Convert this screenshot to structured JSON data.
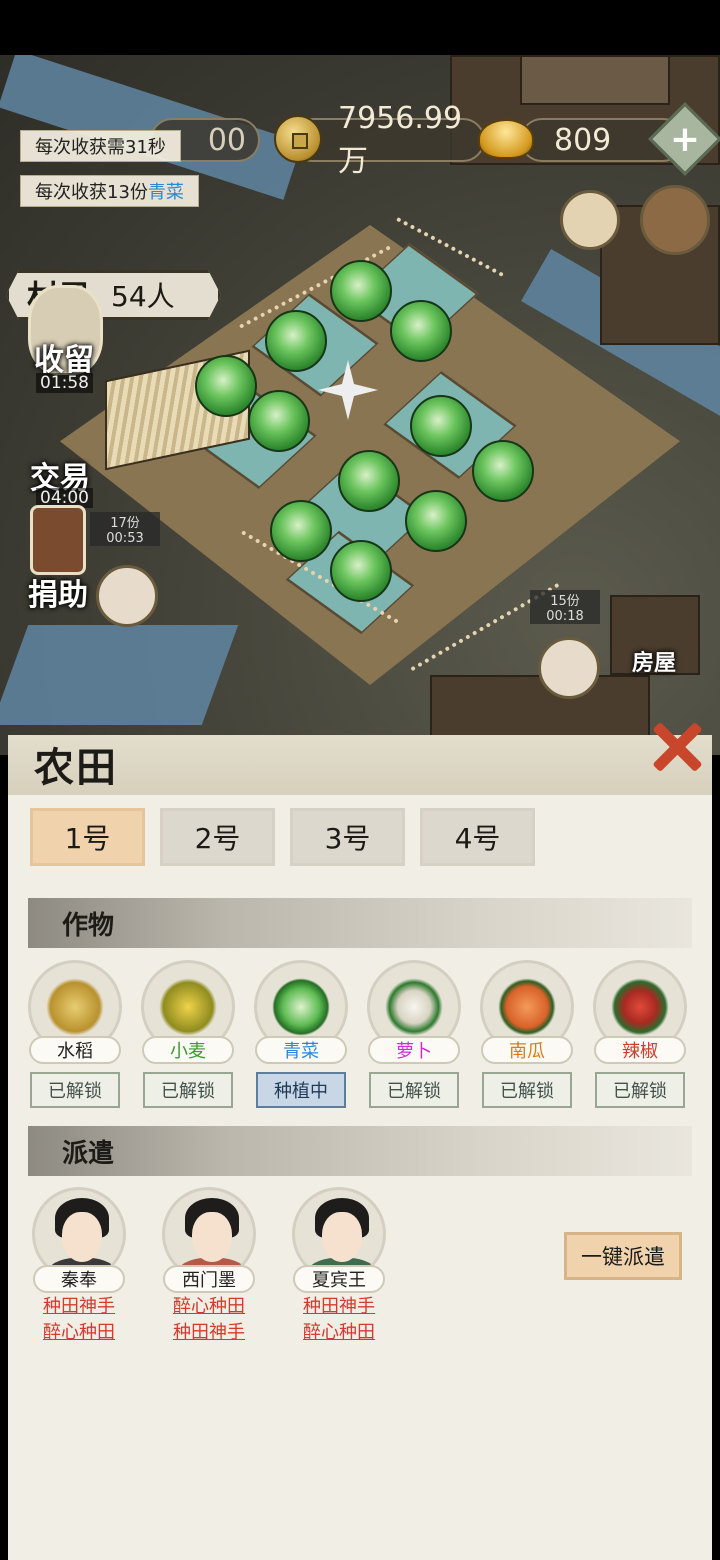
{
  "resources": {
    "coins": "7956.99万",
    "ingots": "809",
    "hidden_value": "00"
  },
  "tips": {
    "harvest_time": "每次收获需31秒",
    "harvest_amount_prefix": "每次收获13份",
    "harvest_amount_crop": "青菜"
  },
  "villager": {
    "label": "村民",
    "count": "54人"
  },
  "side_buttons": {
    "shelter": {
      "label": "收留",
      "timer": "01:58"
    },
    "trade": {
      "label": "交易",
      "timer": "04:00"
    },
    "donate": {
      "label": "捐助"
    }
  },
  "map_badges": {
    "left": {
      "amount": "17份",
      "timer": "00:53"
    },
    "right": {
      "amount": "15份",
      "timer": "00:18"
    },
    "house_label": "房屋"
  },
  "panel": {
    "title": "农田",
    "tabs": [
      "1号",
      "2号",
      "3号",
      "4号"
    ],
    "active_tab": 0,
    "crops_section": "作物",
    "crops": [
      {
        "name": "水稻",
        "status": "已解锁",
        "color": "#222222",
        "plant": "rice-plant-icon",
        "plantColor": "#c9a646"
      },
      {
        "name": "小麦",
        "status": "已解锁",
        "color": "#3a9a2b",
        "plant": "wheat-plant-icon",
        "plantColor": "#d7b036"
      },
      {
        "name": "青菜",
        "status": "种植中",
        "color": "#2a86d6",
        "plant": "cabbage-plant-icon",
        "plantColor": "#5dbb52"
      },
      {
        "name": "萝卜",
        "status": "已解锁",
        "color": "#d02bd0",
        "plant": "radish-plant-icon",
        "plantColor": "#e8e4d8"
      },
      {
        "name": "南瓜",
        "status": "已解锁",
        "color": "#e07b14",
        "plant": "pumpkin-plant-icon",
        "plantColor": "#e0742c"
      },
      {
        "name": "辣椒",
        "status": "已解锁",
        "color": "#d23b2e",
        "plant": "chili-plant-icon",
        "plantColor": "#c9302a"
      }
    ],
    "dispatch_section": "派遣",
    "workers": [
      {
        "name": "秦奉",
        "skills": [
          "种田神手",
          "醉心种田"
        ]
      },
      {
        "name": "西门墨",
        "skills": [
          "醉心种田",
          "种田神手"
        ]
      },
      {
        "name": "夏宾王",
        "skills": [
          "种田神手",
          "醉心种田"
        ]
      }
    ],
    "dispatch_button": "一键派遣"
  }
}
